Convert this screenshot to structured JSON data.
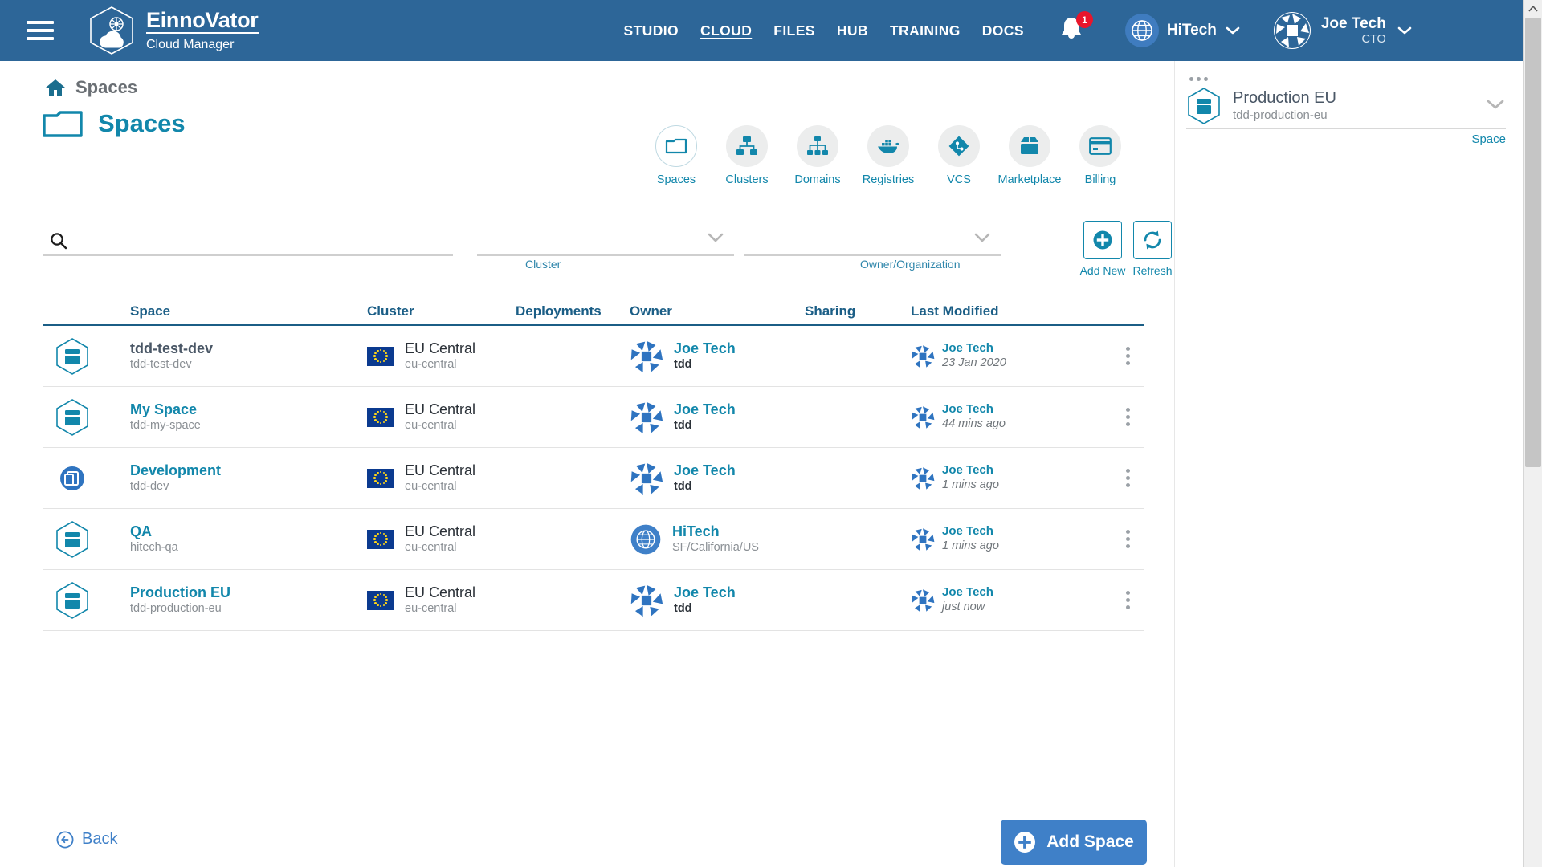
{
  "app": {
    "brand_name": "EinnoVator",
    "brand_subtitle": "Cloud Manager",
    "menu_icon": "hamburger-icon",
    "logo_icon": "cloud-hexagon-logo"
  },
  "topnav": {
    "items": [
      {
        "label": "STUDIO",
        "active": false
      },
      {
        "label": "CLOUD",
        "active": true
      },
      {
        "label": "FILES",
        "active": false
      },
      {
        "label": "HUB",
        "active": false
      },
      {
        "label": "TRAINING",
        "active": false
      },
      {
        "label": "DOCS",
        "active": false
      }
    ],
    "notifications": {
      "icon": "bell-icon",
      "count": "1"
    },
    "organization": {
      "icon": "globe-icon",
      "name": "HiTech",
      "chevron": "chevron-down-icon"
    },
    "user": {
      "avatar": "user-avatar",
      "name": "Joe Tech",
      "role": "CTO",
      "chevron": "chevron-down-icon"
    }
  },
  "breadcrumb": {
    "home_icon": "home-icon",
    "label": "Spaces"
  },
  "page": {
    "icon": "folder-icon",
    "title": "Spaces"
  },
  "iconbar": {
    "items": [
      {
        "label": "Spaces",
        "icon": "folder-icon",
        "selected": true
      },
      {
        "label": "Clusters",
        "icon": "cluster-nodes-icon",
        "selected": false
      },
      {
        "label": "Domains",
        "icon": "hierarchy-icon",
        "selected": false
      },
      {
        "label": "Registries",
        "icon": "docker-whale-icon",
        "selected": false
      },
      {
        "label": "VCS",
        "icon": "git-branch-icon",
        "selected": false
      },
      {
        "label": "Marketplace",
        "icon": "box-open-icon",
        "selected": false
      },
      {
        "label": "Billing",
        "icon": "credit-card-icon",
        "selected": false
      }
    ]
  },
  "filters": {
    "search": {
      "icon": "search-icon",
      "value": "",
      "placeholder": ""
    },
    "cluster": {
      "label": "Cluster",
      "value": "",
      "chevron": "chevron-down-icon"
    },
    "owner": {
      "label": "Owner/Organization",
      "value": "",
      "chevron": "chevron-down-icon"
    },
    "add_new": {
      "label": "Add New",
      "icon": "plus-circle-icon"
    },
    "refresh": {
      "label": "Refresh",
      "icon": "refresh-icon"
    }
  },
  "table": {
    "columns": [
      "Space",
      "Cluster",
      "Deployments",
      "Owner",
      "Sharing",
      "Last Modified"
    ],
    "rows": [
      {
        "space_icon": "space-hexagon-icon",
        "space_name": "tdd-test-dev",
        "space_name_muted": true,
        "space_id": "tdd-test-dev",
        "cluster_icon": "eu-flag-icon",
        "cluster_name": "EU Central",
        "cluster_id": "eu-central",
        "deployments": "",
        "owner_icon": "user-avatar",
        "owner_name": "Joe Tech",
        "owner_org": "tdd",
        "sharing": "",
        "modified_icon": "user-avatar",
        "modified_by": "Joe Tech",
        "modified_when": "23 Jan 2020",
        "menu_icon": "kebab-menu-icon"
      },
      {
        "space_icon": "space-hexagon-icon",
        "space_name": "My Space",
        "space_name_muted": false,
        "space_id": "tdd-my-space",
        "cluster_icon": "eu-flag-icon",
        "cluster_name": "EU Central",
        "cluster_id": "eu-central",
        "deployments": "",
        "owner_icon": "user-avatar",
        "owner_name": "Joe Tech",
        "owner_org": "tdd",
        "sharing": "",
        "modified_icon": "user-avatar",
        "modified_by": "Joe Tech",
        "modified_when": "44 mins ago",
        "menu_icon": "kebab-menu-icon"
      },
      {
        "space_icon": "space-stack-circle-icon",
        "space_name": "Development",
        "space_name_muted": false,
        "space_id": "tdd-dev",
        "cluster_icon": "eu-flag-icon",
        "cluster_name": "EU Central",
        "cluster_id": "eu-central",
        "deployments": "",
        "owner_icon": "user-avatar",
        "owner_name": "Joe Tech",
        "owner_org": "tdd",
        "sharing": "",
        "modified_icon": "user-avatar",
        "modified_by": "Joe Tech",
        "modified_when": "1 mins ago",
        "menu_icon": "kebab-menu-icon"
      },
      {
        "space_icon": "space-hexagon-icon",
        "space_name": "QA",
        "space_name_muted": false,
        "space_id": "hitech-qa",
        "cluster_icon": "eu-flag-icon",
        "cluster_name": "EU Central",
        "cluster_id": "eu-central",
        "deployments": "",
        "owner_icon": "globe-icon",
        "owner_name": "HiTech",
        "owner_org": "SF/California/US",
        "sharing": "",
        "modified_icon": "user-avatar",
        "modified_by": "Joe Tech",
        "modified_when": "1 mins ago",
        "menu_icon": "kebab-menu-icon"
      },
      {
        "space_icon": "space-hexagon-icon",
        "space_name": "Production EU",
        "space_name_muted": false,
        "space_id": "tdd-production-eu",
        "cluster_icon": "eu-flag-icon",
        "cluster_name": "EU Central",
        "cluster_id": "eu-central",
        "deployments": "",
        "owner_icon": "user-avatar",
        "owner_name": "Joe Tech",
        "owner_org": "tdd",
        "sharing": "",
        "modified_icon": "user-avatar",
        "modified_by": "Joe Tech",
        "modified_when": "just now",
        "menu_icon": "kebab-menu-icon"
      }
    ]
  },
  "footer": {
    "back": {
      "label": "Back",
      "icon": "arrow-left-circle-icon"
    },
    "add_space": {
      "label": "Add Space",
      "icon": "plus-circle-icon"
    }
  },
  "right_panel": {
    "dots_icon": "kebab-horizontal-icon",
    "icon": "space-hexagon-icon",
    "title": "Production EU",
    "subtitle": "tdd-production-eu",
    "chevron": "chevron-down-icon",
    "caption": "Space"
  },
  "colors": {
    "header_blue": "#2d6698",
    "accent_teal": "#1287ab",
    "table_header_blue": "#1b5e86",
    "button_blue": "#3f80c8",
    "badge_red": "#e8162c",
    "muted_gray": "#8a8f94"
  }
}
